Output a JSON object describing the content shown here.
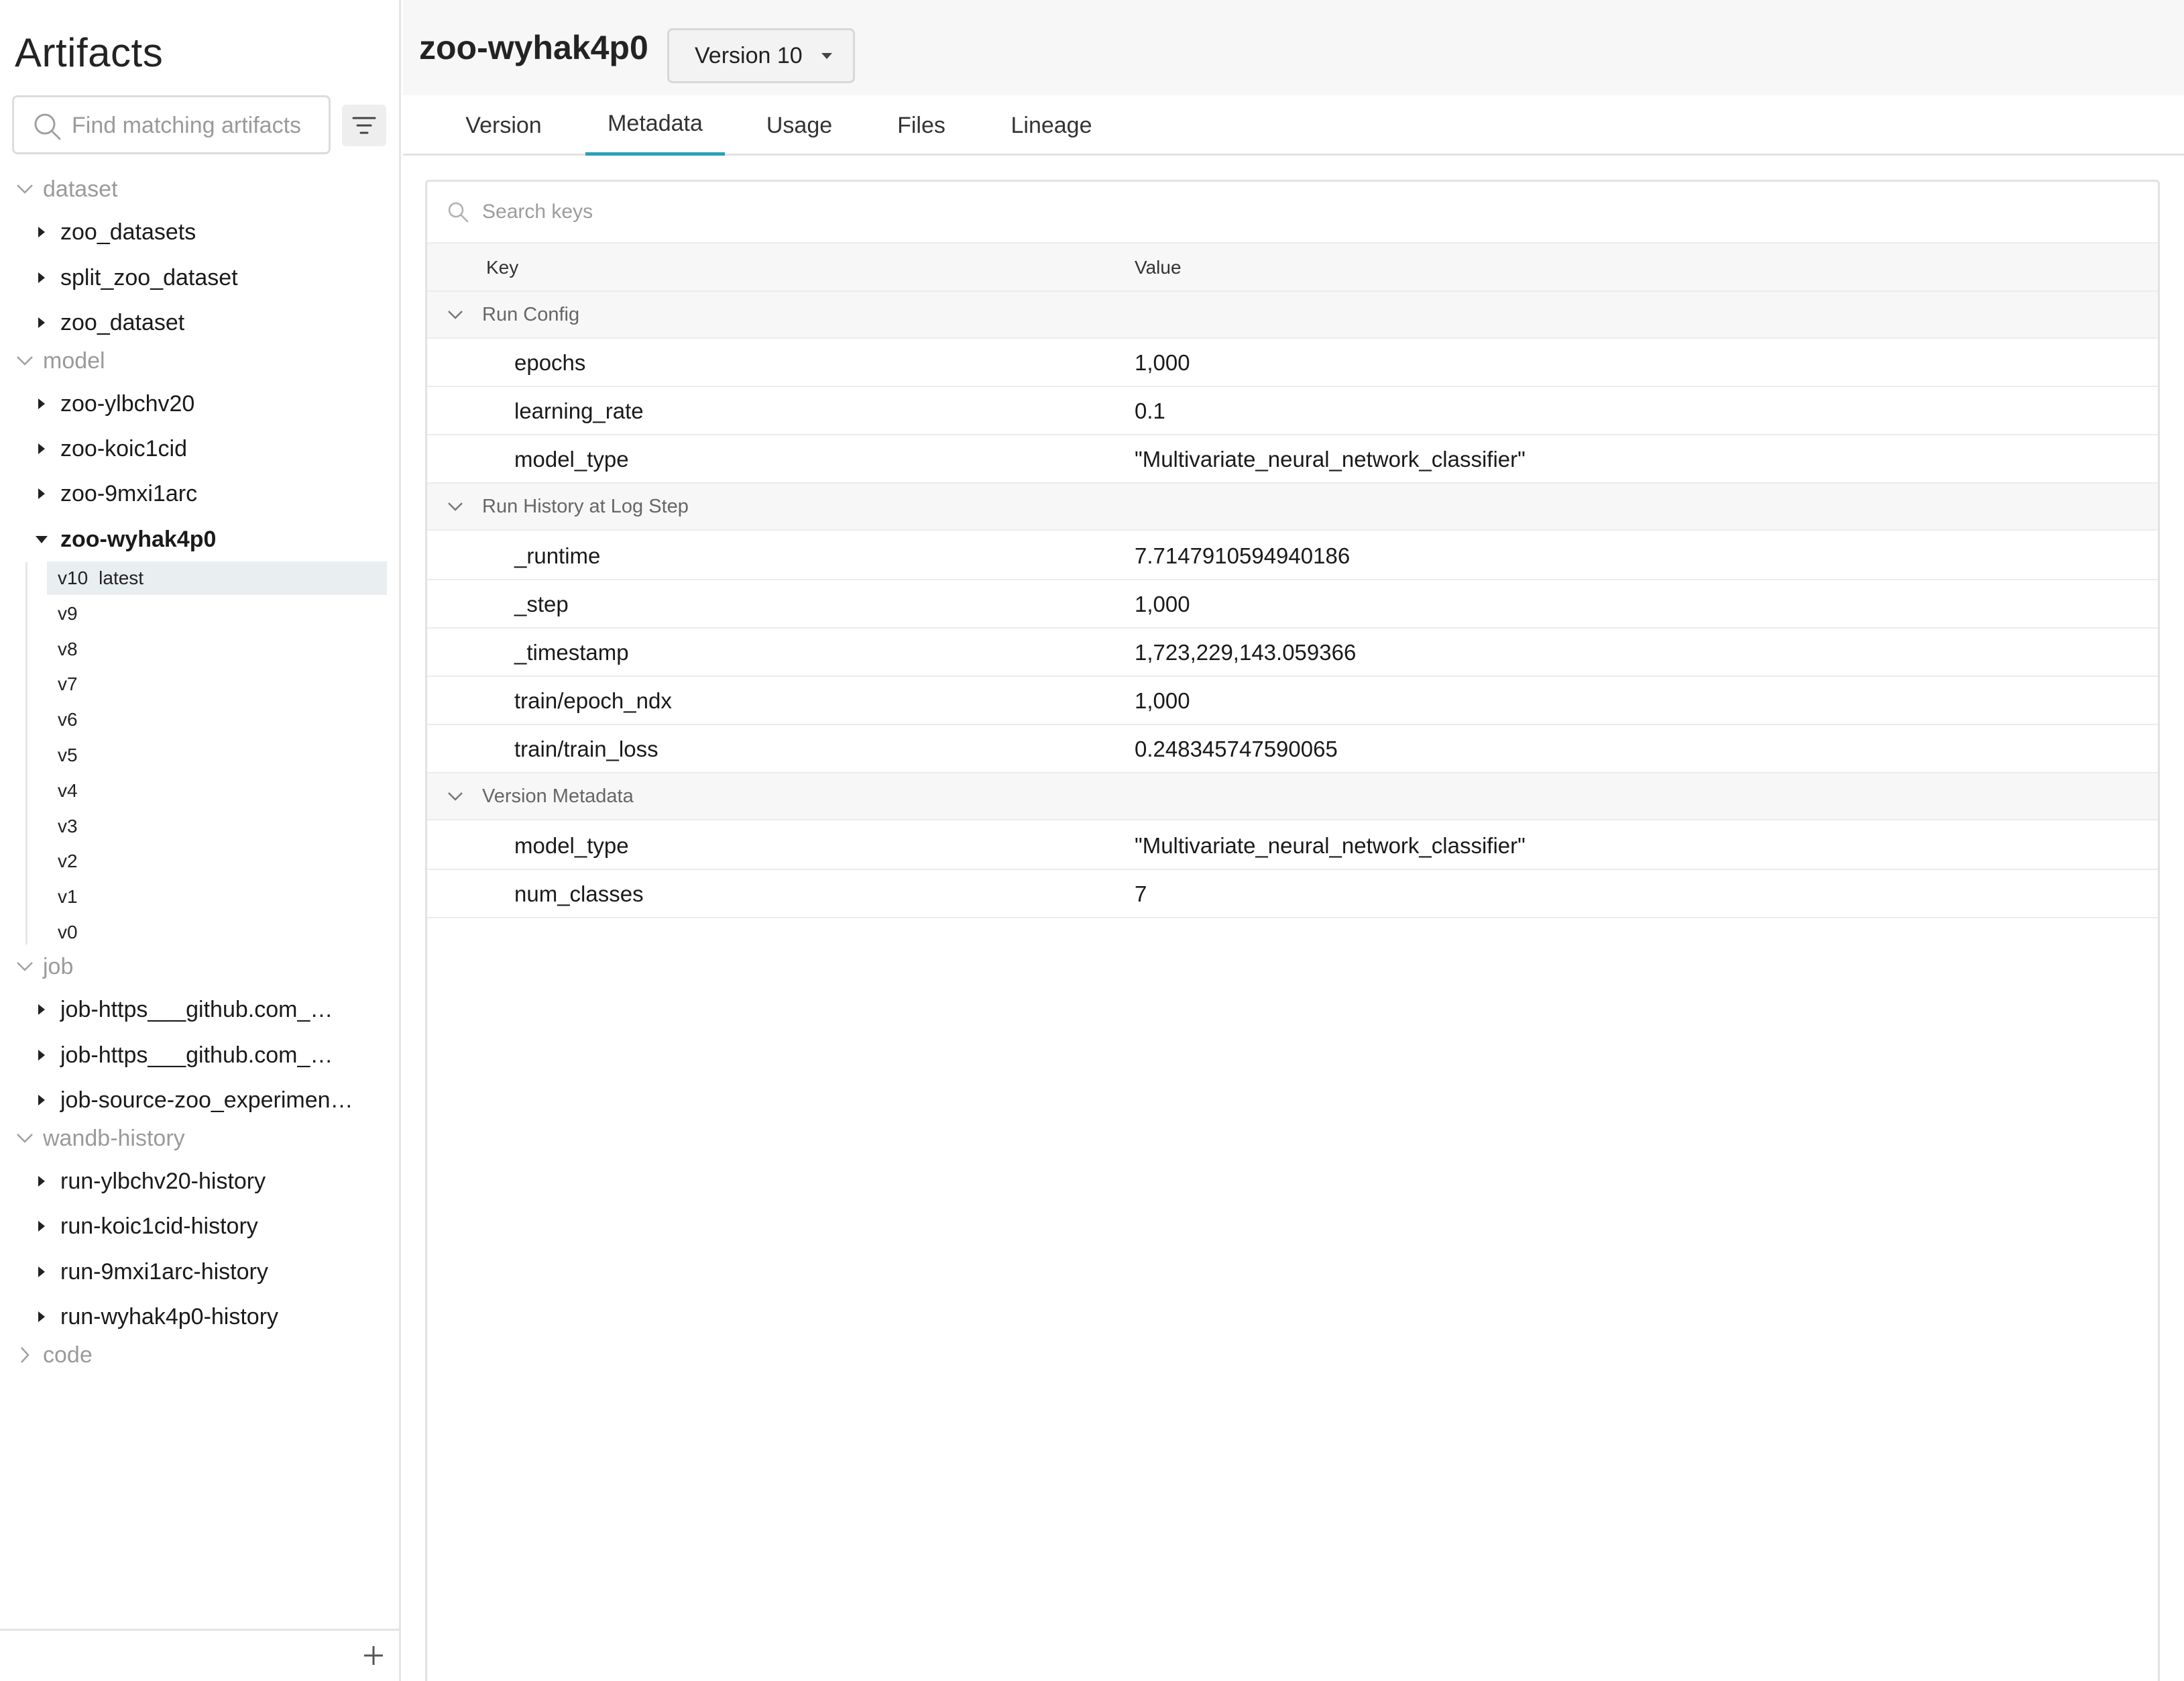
{
  "sidebar": {
    "title": "Artifacts",
    "search_placeholder": "Find matching artifacts",
    "groups": [
      {
        "name": "dataset",
        "items": [
          "zoo_datasets",
          "split_zoo_dataset",
          "zoo_dataset"
        ]
      },
      {
        "name": "model",
        "items": [
          "zoo-ylbchv20",
          "zoo-koic1cid",
          "zoo-9mxi1arc",
          "zoo-wyhak4p0"
        ]
      },
      {
        "name": "job",
        "items": [
          "job-https___github.com_…",
          "job-https___github.com_…",
          "job-source-zoo_experimen…"
        ]
      },
      {
        "name": "wandb-history",
        "items": [
          "run-ylbchv20-history",
          "run-koic1cid-history",
          "run-9mxi1arc-history",
          "run-wyhak4p0-history"
        ]
      },
      {
        "name": "code",
        "items": []
      }
    ],
    "versions": [
      {
        "label": "v10",
        "tag": "latest"
      },
      {
        "label": "v9"
      },
      {
        "label": "v8"
      },
      {
        "label": "v7"
      },
      {
        "label": "v6"
      },
      {
        "label": "v5"
      },
      {
        "label": "v4"
      },
      {
        "label": "v3"
      },
      {
        "label": "v2"
      },
      {
        "label": "v1"
      },
      {
        "label": "v0"
      }
    ]
  },
  "header": {
    "title": "zoo-wyhak4p0",
    "version_select": "Version 10"
  },
  "tabs": [
    "Version",
    "Metadata",
    "Usage",
    "Files",
    "Lineage"
  ],
  "active_tab": "Metadata",
  "metadata": {
    "search_placeholder": "Search keys",
    "col_key": "Key",
    "col_value": "Value",
    "sections": [
      {
        "title": "Run Config",
        "rows": [
          {
            "key": "epochs",
            "value": "1,000"
          },
          {
            "key": "learning_rate",
            "value": "0.1"
          },
          {
            "key": "model_type",
            "value": "\"Multivariate_neural_network_classifier\""
          }
        ]
      },
      {
        "title": "Run History at Log Step",
        "rows": [
          {
            "key": "_runtime",
            "value": "7.7147910594940186"
          },
          {
            "key": "_step",
            "value": "1,000"
          },
          {
            "key": "_timestamp",
            "value": "1,723,229,143.059366"
          },
          {
            "key": "train/epoch_ndx",
            "value": "1,000"
          },
          {
            "key": "train/train_loss",
            "value": "0.248345747590065"
          }
        ]
      },
      {
        "title": "Version Metadata",
        "rows": [
          {
            "key": "model_type",
            "value": "\"Multivariate_neural_network_classifier\""
          },
          {
            "key": "num_classes",
            "value": "7"
          }
        ]
      }
    ]
  }
}
